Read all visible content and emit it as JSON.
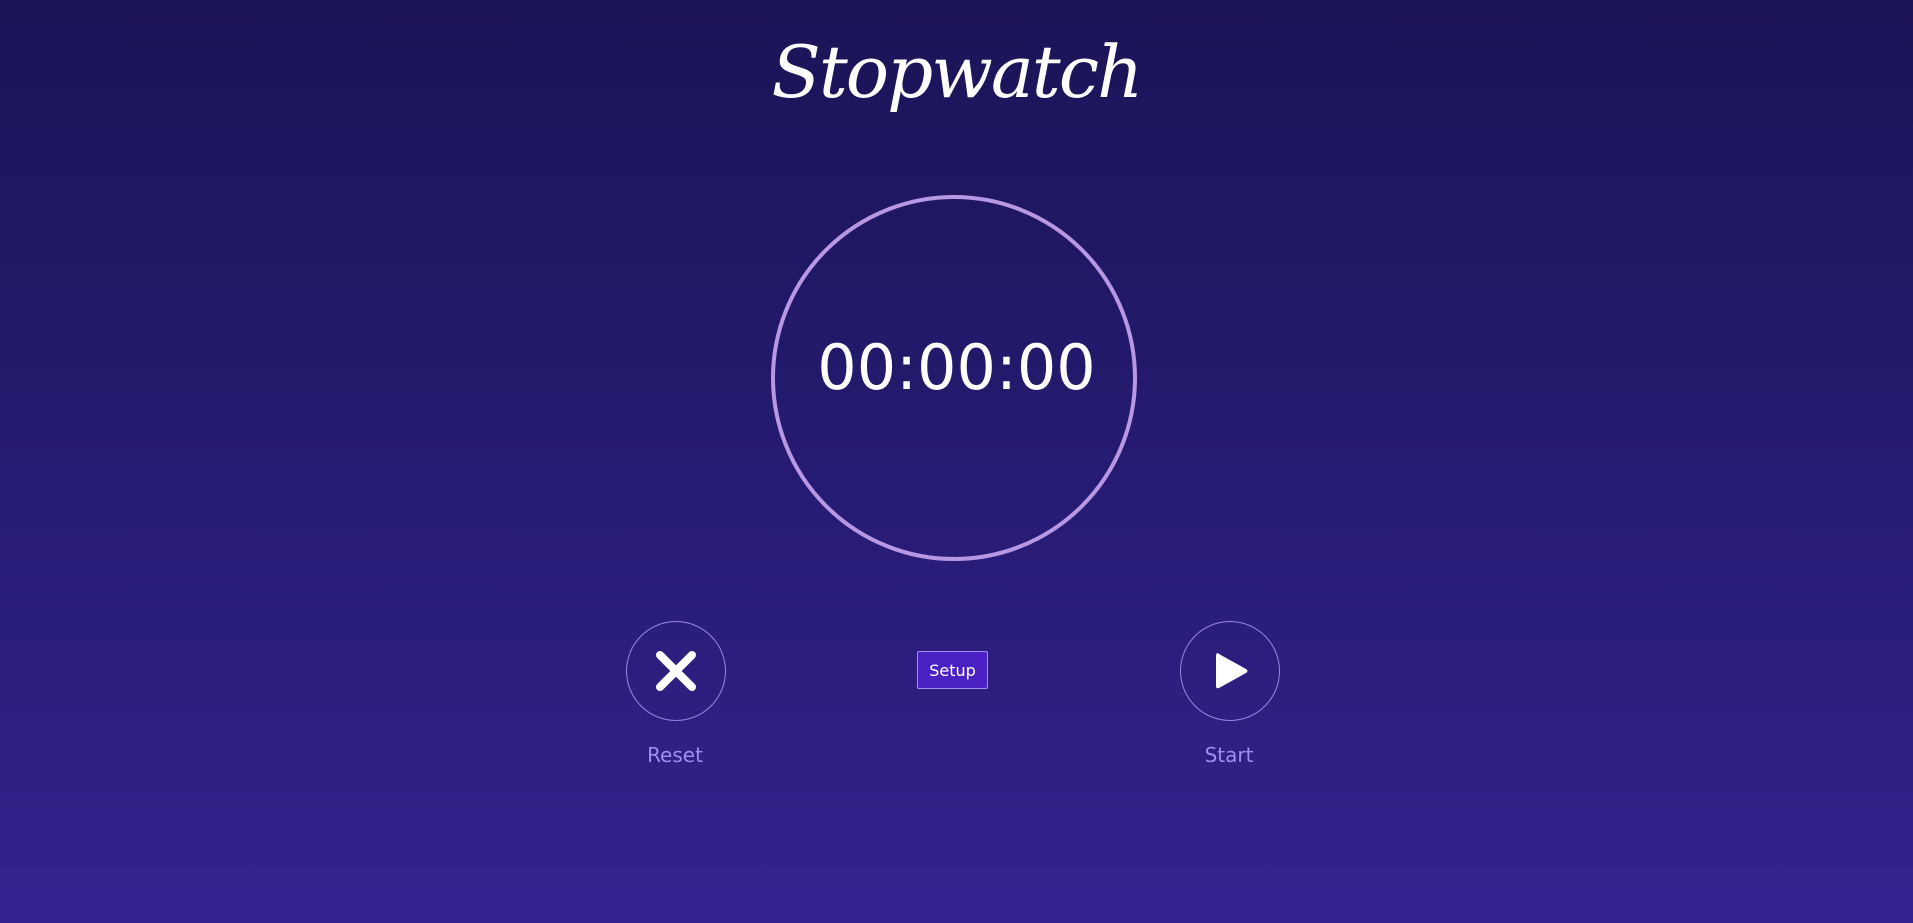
{
  "app": {
    "title": "Stopwatch"
  },
  "display": {
    "time": "00:00:00"
  },
  "controls": {
    "reset_label": "Reset",
    "reset_icon": "close-icon",
    "setup_label": "Setup",
    "start_label": "Start",
    "start_icon": "play-icon"
  },
  "colors": {
    "background_top": "#1b1456",
    "background_bottom": "#33238f",
    "dial_ring": "#b897e3",
    "label": "#9d8ef0",
    "setup_button": "#4a22c4"
  }
}
